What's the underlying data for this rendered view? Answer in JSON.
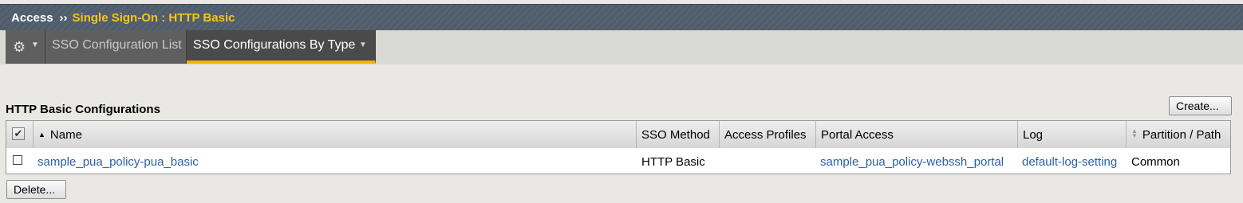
{
  "breadcrumb": {
    "root": "Access",
    "separator": "››",
    "current": "Single Sign-On : HTTP Basic"
  },
  "tabs": {
    "gear_icon": "gear-icon",
    "list_label": "SSO Configuration List",
    "by_type_label": "SSO Configurations By Type"
  },
  "section": {
    "title": "HTTP Basic Configurations",
    "create_label": "Create...",
    "delete_label": "Delete..."
  },
  "table": {
    "columns": {
      "name": "Name",
      "sso_method": "SSO Method",
      "access_profiles": "Access Profiles",
      "portal_access": "Portal Access",
      "log": "Log",
      "partition": "Partition / Path"
    },
    "rows": [
      {
        "name": "sample_pua_policy-pua_basic",
        "sso_method": "HTTP Basic",
        "access_profiles": "",
        "portal_access": "sample_pua_policy-webssh_portal",
        "log": "default-log-setting",
        "partition": "Common"
      }
    ]
  },
  "colors": {
    "title_bar": "#55626f",
    "breadcrumb_current": "#f5c518",
    "active_tab_underline": "#f4b400",
    "link": "#2b5fa8"
  }
}
